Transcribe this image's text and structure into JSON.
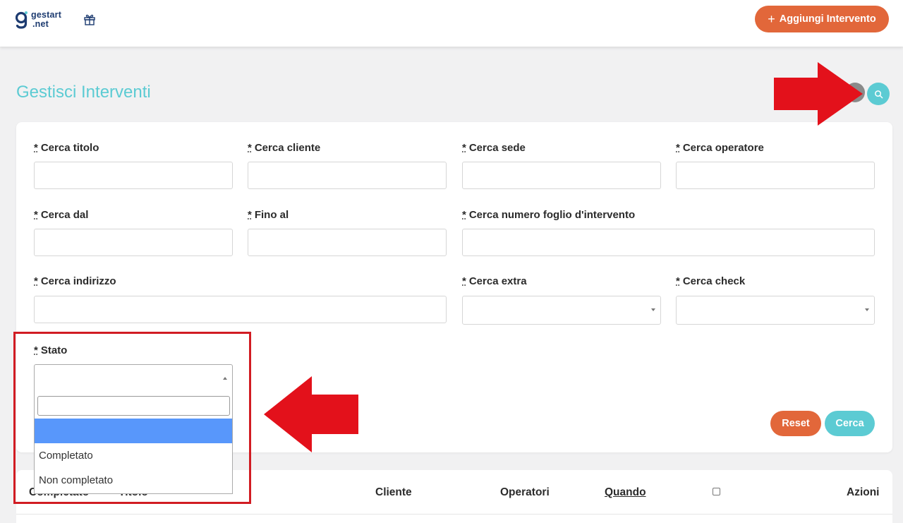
{
  "header": {
    "logo_line1": "gestart",
    "logo_line2": ".net",
    "add_button_label": "Aggiungi Intervento",
    "add_button_plus": "+"
  },
  "page": {
    "title": "Gestisci Interventi"
  },
  "filters": {
    "asterisk": "*",
    "cerca_titolo": "Cerca titolo",
    "cerca_cliente": "Cerca cliente",
    "cerca_sede": "Cerca sede",
    "cerca_operatore": "Cerca operatore",
    "cerca_dal": "Cerca dal",
    "fino_al": "Fino al",
    "cerca_numero_foglio": "Cerca numero foglio d'intervento",
    "cerca_indirizzo": "Cerca indirizzo",
    "cerca_extra": "Cerca extra",
    "cerca_check": "Cerca check",
    "stato": "Stato",
    "reset_label": "Reset",
    "cerca_label": "Cerca"
  },
  "stato_dropdown": {
    "options": [
      "",
      "Completato",
      "Non completato"
    ],
    "highlighted_index": 0
  },
  "table": {
    "headers": {
      "completato": "Completato",
      "titolo": "Titolo",
      "cliente": "Cliente",
      "operatori": "Operatori",
      "quando": "Quando",
      "azioni": "Azioni"
    }
  },
  "colors": {
    "brand_teal": "#5ccbd3",
    "brand_orange": "#e2673a",
    "annotation_red": "#d11c23",
    "highlight_blue": "#5897fb"
  },
  "icons": {
    "logo": "gestart-logo-icon",
    "gift": "gift-icon",
    "search": "search-icon"
  }
}
